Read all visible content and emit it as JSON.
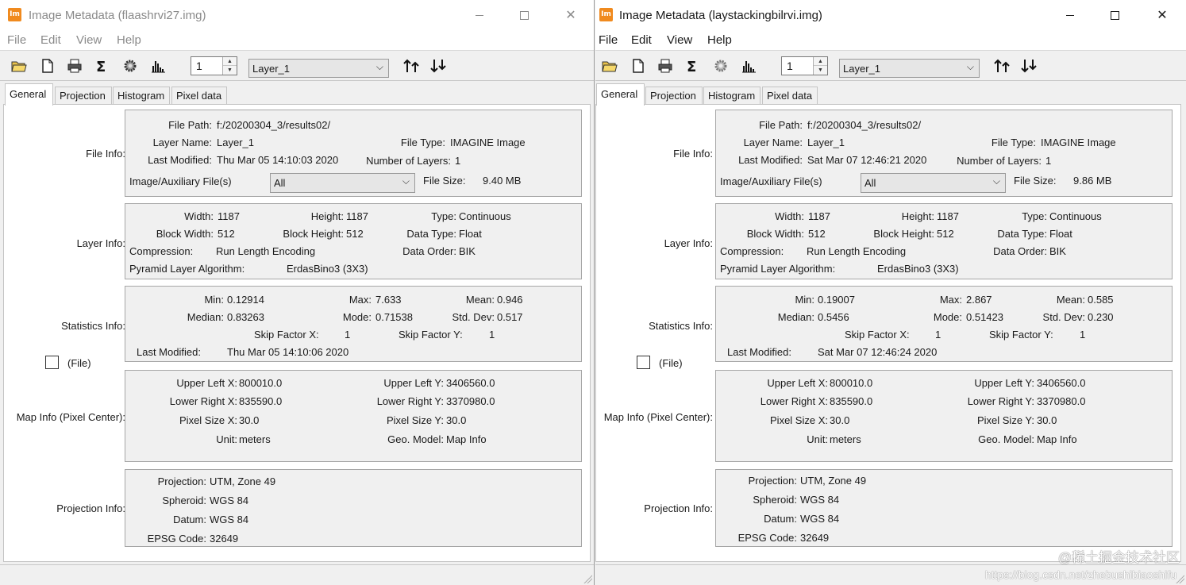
{
  "app_icon_text": "Im",
  "menus": [
    "File",
    "Edit",
    "View",
    "Help"
  ],
  "tabs": [
    "General",
    "Projection",
    "Histogram",
    "Pixel data"
  ],
  "toolbar_icons": [
    "open-folder-icon",
    "new-document-icon",
    "print-icon",
    "sigma-icon",
    "gear-icon",
    "histogram-icon",
    "sort-up-icon",
    "sort-down-icon"
  ],
  "labels": {
    "file_info": "File Info:",
    "file_path": "File Path:",
    "layer_name": "Layer Name:",
    "file_type": "File Type:",
    "last_modified": "Last Modified:",
    "num_layers": "Number of Layers:",
    "aux_files": "Image/Auxiliary File(s)",
    "file_size": "File Size:",
    "layer_info": "Layer Info:",
    "width": "Width:",
    "height": "Height:",
    "type": "Type:",
    "block_width": "Block Width:",
    "block_height": "Block Height:",
    "data_type": "Data Type:",
    "compression": "Compression:",
    "data_order": "Data Order:",
    "pyramid": "Pyramid Layer Algorithm:",
    "statistics_info": "Statistics Info:",
    "min": "Min:",
    "max": "Max:",
    "mean": "Mean:",
    "median": "Median:",
    "mode": "Mode:",
    "std_dev": "Std. Dev:",
    "skip_x": "Skip Factor X:",
    "skip_y": "Skip Factor Y:",
    "stats_last_modified": "Last Modified:",
    "file_checkbox": "(File)",
    "map_info": "Map Info (Pixel Center):",
    "upper_left_x": "Upper Left X:",
    "upper_left_y": "Upper Left Y:",
    "lower_right_x": "Lower Right X:",
    "lower_right_y": "Lower Right Y:",
    "pixel_size_x": "Pixel Size X:",
    "pixel_size_y": "Pixel Size Y:",
    "unit": "Unit:",
    "geo_model": "Geo. Model:",
    "projection_info": "Projection Info:",
    "projection": "Projection:",
    "spheroid": "Spheroid:",
    "datum": "Datum:",
    "epsg": "EPSG Code:"
  },
  "windows": [
    {
      "title": "Image Metadata (flaashrvi27.img)",
      "layer_number": "1",
      "layer_select": "Layer_1",
      "file": {
        "path": "f:/20200304_3/results02/",
        "layer_name": "Layer_1",
        "type": "IMAGINE Image",
        "last_modified": "Thu Mar 05 14:10:03 2020",
        "num_layers": "1",
        "aux_select": "All",
        "size": "9.40 MB"
      },
      "layer": {
        "width": "1187",
        "height": "1187",
        "type": "Continuous",
        "block_width": "512",
        "block_height": "512",
        "data_type": "Float",
        "compression": "Run Length Encoding",
        "data_order": "BIK",
        "pyramid": "ErdasBino3 (3X3)"
      },
      "stats": {
        "min": "0.12914",
        "max": "7.633",
        "mean": "0.946",
        "median": "0.83263",
        "mode": "0.71538",
        "std_dev": "0.517",
        "skip_x": "1",
        "skip_y": "1",
        "last_modified": "Thu Mar 05 14:10:06 2020"
      },
      "map": {
        "upper_left_x": "800010.0",
        "upper_left_y": "3406560.0",
        "lower_right_x": "835590.0",
        "lower_right_y": "3370980.0",
        "pixel_size_x": "30.0",
        "pixel_size_y": "30.0",
        "unit": "meters",
        "geo_model": "Map Info"
      },
      "proj": {
        "projection": "UTM, Zone 49",
        "spheroid": "WGS 84",
        "datum": "WGS 84",
        "epsg": "32649"
      }
    },
    {
      "title": "Image Metadata (laystackingbilrvi.img)",
      "layer_number": "1",
      "layer_select": "Layer_1",
      "file": {
        "path": "f:/20200304_3/results02/",
        "layer_name": "Layer_1",
        "type": "IMAGINE Image",
        "last_modified": "Sat Mar 07 12:46:21 2020",
        "num_layers": "1",
        "aux_select": "All",
        "size": "9.86 MB"
      },
      "layer": {
        "width": "1187",
        "height": "1187",
        "type": "Continuous",
        "block_width": "512",
        "block_height": "512",
        "data_type": "Float",
        "compression": "Run Length Encoding",
        "data_order": "BIK",
        "pyramid": "ErdasBino3 (3X3)"
      },
      "stats": {
        "min": "0.19007",
        "max": "2.867",
        "mean": "0.585",
        "median": "0.5456",
        "mode": "0.51423",
        "std_dev": "0.230",
        "skip_x": "1",
        "skip_y": "1",
        "last_modified": "Sat Mar 07 12:46:24 2020"
      },
      "map": {
        "upper_left_x": "800010.0",
        "upper_left_y": "3406560.0",
        "lower_right_x": "835590.0",
        "lower_right_y": "3370980.0",
        "pixel_size_x": "30.0",
        "pixel_size_y": "30.0",
        "unit": "meters",
        "geo_model": "Map Info"
      },
      "proj": {
        "projection": "UTM, Zone 49",
        "spheroid": "WGS 84",
        "datum": "WGS 84",
        "epsg": "32649"
      }
    }
  ],
  "watermark": {
    "line1": "@稀土掘金技术社区",
    "line2": "https://blog.csdn.net/zhebushibiaoshifu"
  }
}
